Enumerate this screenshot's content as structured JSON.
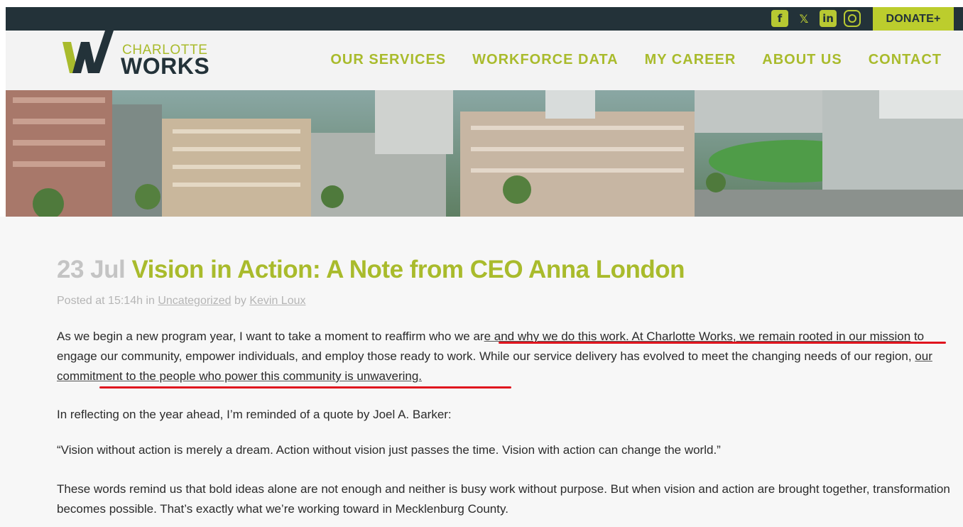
{
  "topbar": {
    "social": [
      {
        "name": "facebook",
        "glyph": "f"
      },
      {
        "name": "x",
        "glyph": "𝕏"
      },
      {
        "name": "linkedin",
        "glyph": "in"
      },
      {
        "name": "instagram",
        "glyph": ""
      }
    ],
    "donate_label": "DONATE+"
  },
  "logo": {
    "top": "CHARLOTTE",
    "bottom": "WORKS"
  },
  "nav": [
    "OUR SERVICES",
    "WORKFORCE DATA",
    "MY CAREER",
    "ABOUT US",
    "CONTACT"
  ],
  "post": {
    "date": "23 Jul",
    "title": "Vision in Action: A Note from CEO Anna London",
    "meta_prefix": "Posted at 15:14h in",
    "category": "Uncategorized",
    "meta_by": "by",
    "author": "Kevin Loux",
    "p1_a": "As we begin a new program year, I want to take a moment to reaffirm who we ar",
    "p1_b": "e and why we do this work. At Charlotte Works, we remain rooted in our mission",
    "p1_c": " to engage our community, empower individuals, and employ those ready to work. While our service delivery has evolved to meet the changing needs of our region, ",
    "p1_d": "our commitment to the people who power this community is unwavering.",
    "p2": "In reflecting on the year ahead, I’m reminded of a quote by Joel A. Barker:",
    "p3": "“Vision without action is merely a dream. Action without vision just passes the time. Vision with action can change the world.”",
    "p4": "These words remind us that bold ideas alone are not enough and neither is busy work without purpose. But when vision and action are brought together, transformation becomes possible. That’s exactly what we’re working toward in Mecklenburg County."
  },
  "colors": {
    "brand_green": "#a9bb2c",
    "dark": "#233239",
    "annotation_red": "#e0141e"
  }
}
